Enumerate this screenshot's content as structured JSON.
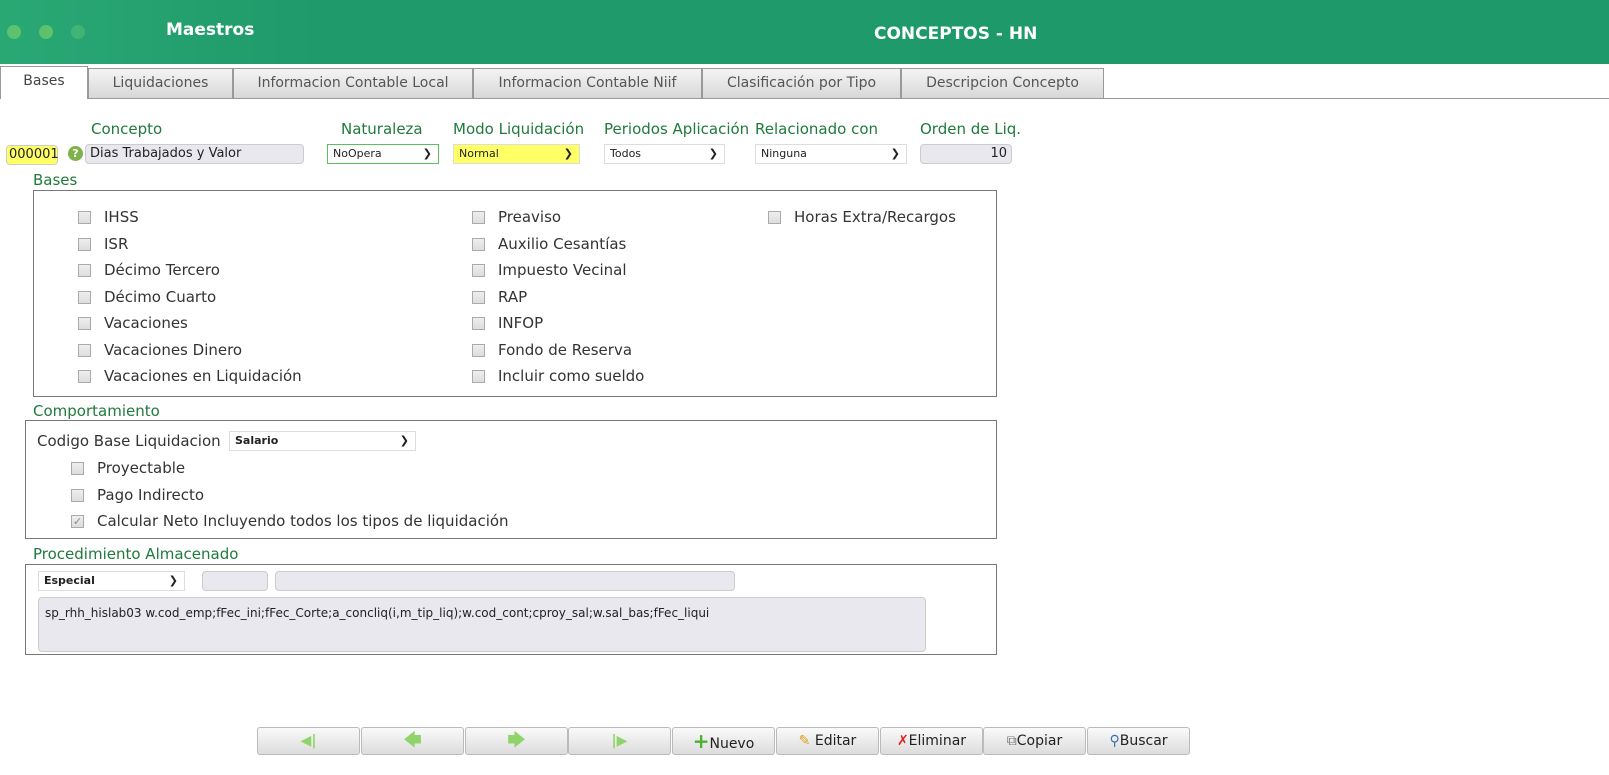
{
  "header": {
    "section": "Maestros",
    "title": "CONCEPTOS - HN"
  },
  "tabs": [
    "Bases",
    "Liquidaciones",
    "Informacion Contable Local",
    "Informacion Contable Niif",
    "Clasificación por Tipo",
    "Descripcion Concepto"
  ],
  "fields": {
    "code": "000001",
    "concepto_label": "Concepto",
    "concepto_value": "Dias Trabajados y Valor",
    "naturaleza_label": "Naturaleza",
    "naturaleza_value": "NoOpera",
    "modo_label": "Modo Liquidación",
    "modo_value": "Normal",
    "periodos_label": "Periodos Aplicación",
    "periodos_value": "Todos",
    "relacionado_label": "Relacionado con",
    "relacionado_value": "Ninguna",
    "orden_label": "Orden de Liq.",
    "orden_value": "10"
  },
  "bases": {
    "label": "Bases",
    "col1": [
      "IHSS",
      "ISR",
      "Décimo Tercero",
      "Décimo Cuarto",
      "Vacaciones",
      "Vacaciones Dinero",
      "Vacaciones en Liquidación"
    ],
    "col2": [
      "Preaviso",
      "Auxilio Cesantías",
      "Impuesto Vecinal",
      "RAP",
      "INFOP",
      "Fondo de Reserva",
      "Incluir como sueldo"
    ],
    "col3": [
      "Horas Extra/Recargos"
    ]
  },
  "comportamiento": {
    "label": "Comportamiento",
    "codigo_label": "Codigo Base Liquidacion",
    "codigo_value": "Salario",
    "checks": [
      {
        "label": "Proyectable",
        "checked": false
      },
      {
        "label": "Pago Indirecto",
        "checked": false
      },
      {
        "label": "Calcular Neto Incluyendo todos los tipos de liquidación",
        "checked": true
      }
    ]
  },
  "procedimiento": {
    "label": "Procedimiento Almacenado",
    "tipo": "Especial",
    "sql": "sp_rhh_hislab03 w.cod_emp;fFec_ini;fFec_Corte;a_concliq(i,m_tip_liq);w.cod_cont;cproy_sal;w.sal_bas;fFec_liqui"
  },
  "toolbar": {
    "nuevo": "Nuevo",
    "editar": "Editar",
    "eliminar": "Eliminar",
    "copiar": "Copiar",
    "buscar": "Buscar"
  }
}
